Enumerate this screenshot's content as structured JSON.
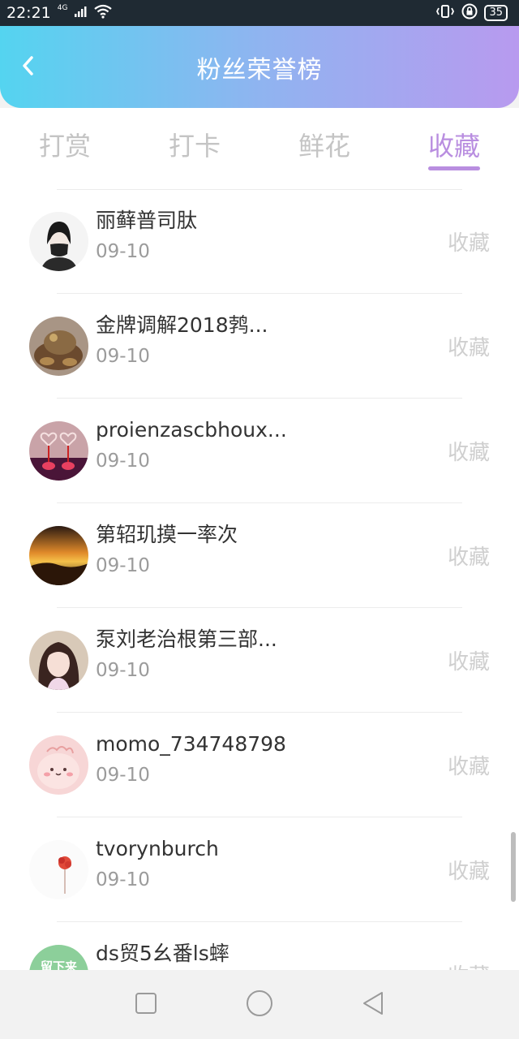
{
  "status_bar": {
    "time": "22:21",
    "network": "4G",
    "battery": "35",
    "icons": [
      "signal-icon",
      "wifi-icon",
      "vibrate-icon",
      "lock-rotation-icon",
      "battery-icon"
    ]
  },
  "header": {
    "title": "粉丝荣誉榜",
    "back_icon": "chevron-left-icon",
    "gradient": [
      "#54d4f0",
      "#b89aef"
    ]
  },
  "tabs": [
    {
      "label": "打赏",
      "active": false
    },
    {
      "label": "打卡",
      "active": false
    },
    {
      "label": "鲜花",
      "active": false
    },
    {
      "label": "收藏",
      "active": true
    }
  ],
  "accent_color": "#b98ee0",
  "items": [
    {
      "name": "丽藓普司肽",
      "date": "09-10",
      "action": "收藏"
    },
    {
      "name": "金牌调解2018鹁...",
      "date": "09-10",
      "action": "收藏"
    },
    {
      "name": "proienzascbhoux...",
      "date": "09-10",
      "action": "收藏"
    },
    {
      "name": "第轺玑摸一率次",
      "date": "09-10",
      "action": "收藏"
    },
    {
      "name": "泵刘老治根第三部...",
      "date": "09-10",
      "action": "收藏"
    },
    {
      "name": "momo_734748798",
      "date": "09-10",
      "action": "收藏"
    },
    {
      "name": "tvorynburch",
      "date": "09-10",
      "action": "收藏"
    },
    {
      "name": "ds贸5幺番ls蟀",
      "date": "",
      "action": "收藏",
      "avatar_text": "留下来"
    }
  ],
  "nav_bar": {
    "icons": [
      "recent-apps-icon",
      "home-icon",
      "back-triangle-icon"
    ]
  }
}
